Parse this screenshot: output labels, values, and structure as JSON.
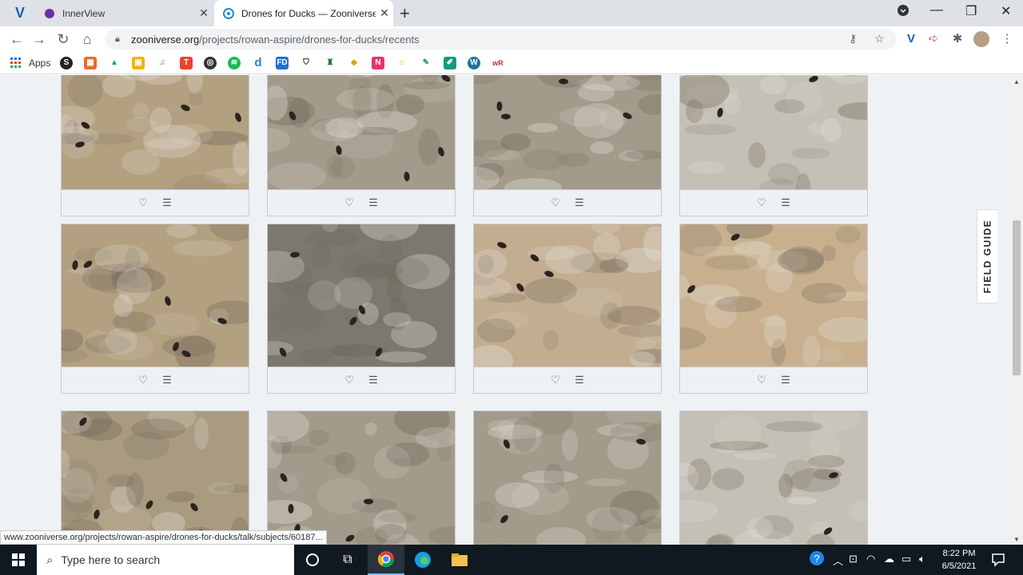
{
  "browser": {
    "tabs": [
      {
        "title": "InnerView",
        "active": false
      },
      {
        "title": "Drones for Ducks — Zooniverse",
        "active": true
      }
    ],
    "new_tab_symbol": "+",
    "close_symbol": "✕",
    "window_controls": {
      "minimize": "—",
      "restore": "❐",
      "close": "✕"
    },
    "nav": {
      "back": "←",
      "forward": "→",
      "reload": "↻",
      "home": "⌂"
    },
    "url_host": "zooniverse.org",
    "url_path": "/projects/rowan-aspire/drones-for-ducks/recents",
    "apps_label": "Apps",
    "status_url": "www.zooniverse.org/projects/rowan-aspire/drones-for-ducks/talk/subjects/60187..."
  },
  "page": {
    "field_guide_label": "FIELD GUIDE",
    "favorite_symbol": "♡",
    "collect_symbol": "☰",
    "subjects": [
      {
        "id": "s1",
        "tone": "brown"
      },
      {
        "id": "s2",
        "tone": "grey-mud"
      },
      {
        "id": "s3",
        "tone": "grey-mud"
      },
      {
        "id": "s4",
        "tone": "grey-light"
      },
      {
        "id": "s5",
        "tone": "brown"
      },
      {
        "id": "s6",
        "tone": "grey-dark"
      },
      {
        "id": "s7",
        "tone": "tan"
      },
      {
        "id": "s8",
        "tone": "sand"
      },
      {
        "id": "s9",
        "tone": "brown-light"
      },
      {
        "id": "s10",
        "tone": "grey-mud"
      },
      {
        "id": "s11",
        "tone": "grey-mud"
      },
      {
        "id": "s12",
        "tone": "grey-light"
      }
    ]
  },
  "taskbar": {
    "search_placeholder": "Type here to search",
    "time": "8:22 PM",
    "date": "6/5/2021"
  },
  "colors": {
    "brown": "#b3a080",
    "brown-light": "#a99b80",
    "grey-mud": "#a29a8a",
    "grey-light": "#c4c0b6",
    "grey-dark": "#7a786f",
    "tan": "#c2ad90",
    "sand": "#c8b08e"
  }
}
